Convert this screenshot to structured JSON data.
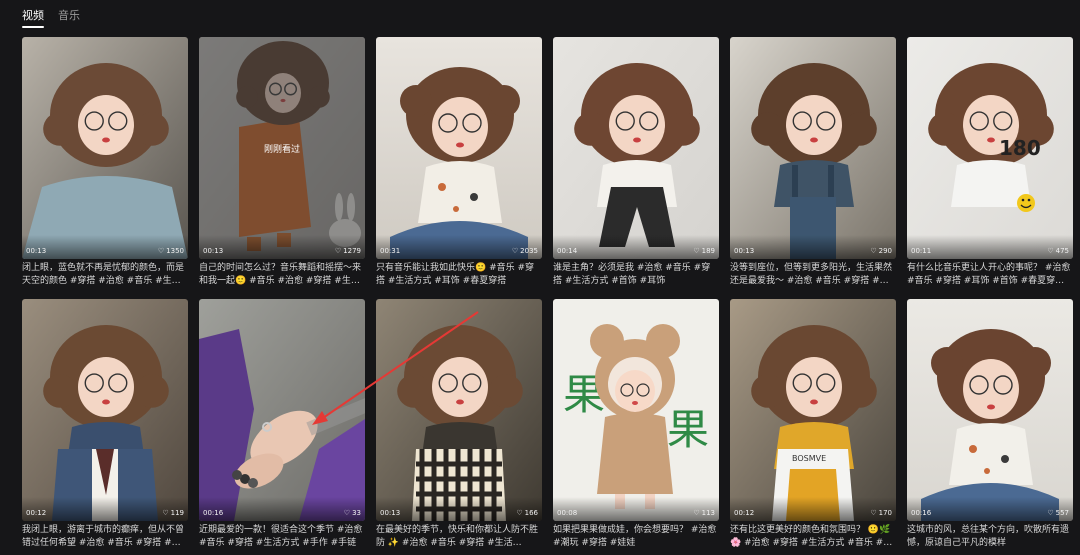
{
  "tabs": [
    {
      "label": "视频",
      "active": true
    },
    {
      "label": "音乐",
      "active": false
    }
  ],
  "cards": [
    {
      "duration": "00:13",
      "likes": "1350",
      "caption": "闭上眼，蓝色就不再是忧郁的颜色，而是天空的颜色 #穿搭 #治愈 #音乐 #生活…",
      "scene": "sweater"
    },
    {
      "duration": "00:13",
      "likes": "1279",
      "caption": "自己的时间怎么过？音乐舞蹈和摇摆～来和我一起🙂 #音乐 #治愈 #穿搭 #生…",
      "scene": "orange",
      "overlay": "刚刚看过"
    },
    {
      "duration": "00:31",
      "likes": "2035",
      "caption": "只有音乐能让我如此快乐🙂 #音乐 #穿搭 #生活方式 #耳饰 #春夏穿搭",
      "scene": "sitting"
    },
    {
      "duration": "00:14",
      "likes": "189",
      "caption": "谁是主角？必须是我 #治愈 #音乐 #穿搭 #生活方式 #首饰 #耳饰",
      "scene": "standing"
    },
    {
      "duration": "00:13",
      "likes": "290",
      "caption": "没等到座位，但等到更多阳光，生活果然还是最爱我～ #治愈 #音乐 #穿搭 #生…",
      "scene": "overalls"
    },
    {
      "duration": "00:11",
      "likes": "475",
      "caption": "有什么比音乐更让人开心的事呢？ #治愈 #音乐 #穿搭 #耳饰 #首饰 #春夏穿搭 …",
      "scene": "smiley"
    },
    {
      "duration": "00:12",
      "likes": "119",
      "caption": "我闭上眼，游离于城市的癫痒，但从不曾错过任何希望 #治愈 #音乐 #穿搭 #生…",
      "scene": "denimvest"
    },
    {
      "duration": "00:16",
      "likes": "33",
      "caption": "近期最爱的一款！很适合这个季节 #治愈 #音乐 #穿搭 #生活方式 #手作 #手链",
      "scene": "hand"
    },
    {
      "duration": "00:13",
      "likes": "166",
      "caption": "在最美好的季节，快乐和你都让人防不胜防 ✨ #治愈 #音乐 #穿搭 #生活…",
      "scene": "plaid"
    },
    {
      "duration": "00:08",
      "likes": "113",
      "caption": "如果把果果做成娃，你会想要吗？ #治愈 #潮玩 #穿搭 #娃娃",
      "scene": "bear"
    },
    {
      "duration": "00:12",
      "likes": "170",
      "caption": "还有比这更美好的颜色和氛围吗？ 🙂🌿🌸 #治愈 #穿搭 #生活方式 #音乐 #…",
      "scene": "yellow"
    },
    {
      "duration": "00:16",
      "likes": "557",
      "caption": "这城市的风，总往某个方向，吹散所有遗憾，原谅自己平凡的模样",
      "scene": "floral"
    }
  ],
  "colors": {
    "background": "#161618",
    "text": "#d8d8d8",
    "active_tab": "#ffffff",
    "annotation_arrow": "#e53935"
  },
  "icons": {
    "likes": "heart-icon"
  }
}
